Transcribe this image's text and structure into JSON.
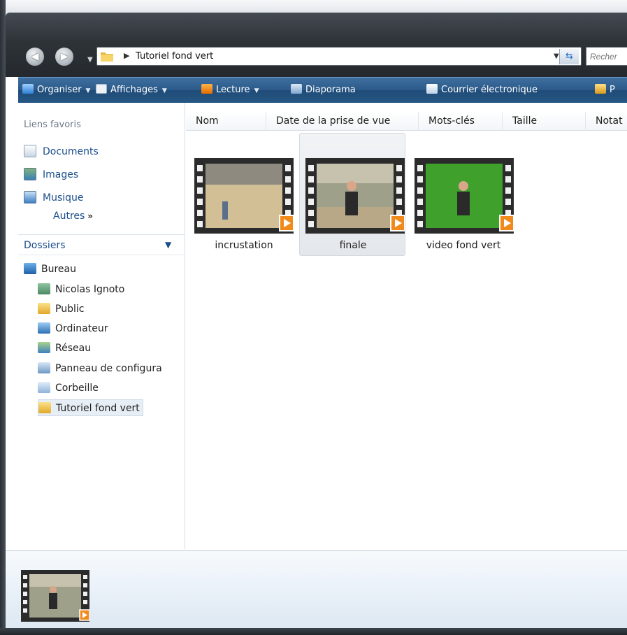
{
  "window": {
    "address_path": "Tutoriel fond vert",
    "search_placeholder": "Recher"
  },
  "toolbar": {
    "items": [
      {
        "label": "Organiser",
        "icon": "organize-icon"
      },
      {
        "label": "Affichages",
        "icon": "views-icon"
      },
      {
        "label": "Lecture",
        "icon": "play-icon"
      },
      {
        "label": "Diaporama",
        "icon": "slideshow-icon"
      },
      {
        "label": "Courrier électronique",
        "icon": "email-icon"
      },
      {
        "label": "P",
        "icon": "share-icon"
      }
    ]
  },
  "navpane": {
    "favorites_title": "Liens favoris",
    "favorites": [
      {
        "label": "Documents",
        "icon": "documents-icon"
      },
      {
        "label": "Images",
        "icon": "images-icon"
      },
      {
        "label": "Musique",
        "icon": "music-icon"
      }
    ],
    "more_label": "Autres",
    "more_arrows": "»",
    "folders_title": "Dossiers",
    "tree": [
      {
        "label": "Bureau",
        "icon": "desktop-icon"
      },
      {
        "label": "Nicolas Ignoto",
        "icon": "user-folder-icon"
      },
      {
        "label": "Public",
        "icon": "folder-icon"
      },
      {
        "label": "Ordinateur",
        "icon": "computer-icon"
      },
      {
        "label": "Réseau",
        "icon": "network-icon"
      },
      {
        "label": "Panneau de configura",
        "icon": "control-panel-icon"
      },
      {
        "label": "Corbeille",
        "icon": "recycle-bin-icon"
      },
      {
        "label": "Tutoriel fond vert",
        "icon": "folder-icon"
      }
    ]
  },
  "columns": [
    "Nom",
    "Date de la prise de vue",
    "Mots-clés",
    "Taille",
    "Notat"
  ],
  "files": [
    {
      "name": "incrustation",
      "icon": "video-file-icon"
    },
    {
      "name": "finale",
      "icon": "video-file-icon"
    },
    {
      "name": "video fond vert",
      "icon": "video-file-icon"
    }
  ],
  "colors": {
    "toolbar": "#2b5a89",
    "link": "#1a4d8c",
    "chrome": "#2e3338"
  }
}
